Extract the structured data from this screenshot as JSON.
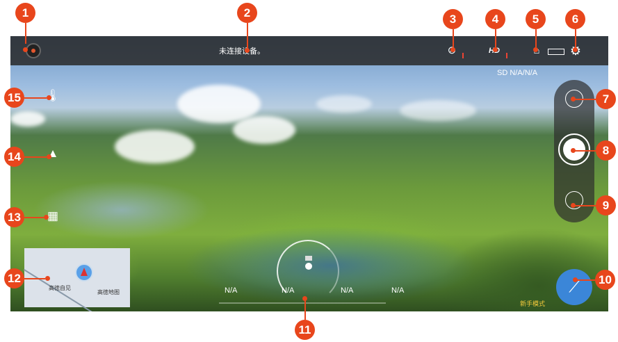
{
  "status": {
    "message": "未连接设备。"
  },
  "sd_card": "SD N/A/N/A",
  "flight_mode_label": "新手模式",
  "telemetry": [
    "N/A",
    "N/A",
    "N/A",
    "N/A"
  ],
  "map": {
    "label_left": "高徳自见",
    "label_right": "高徳地图"
  },
  "callouts": [
    "1",
    "2",
    "3",
    "4",
    "5",
    "6",
    "7",
    "8",
    "9",
    "10",
    "11",
    "12",
    "13",
    "14",
    "15"
  ],
  "icons": {
    "record": "record-icon",
    "no_gps": "satellite-off-icon",
    "hd_signal": "hd-signal-icon",
    "drone_signal": "drone-signal-icon",
    "battery": "battery-icon",
    "settings": "gear-icon",
    "camera_switch": "camera-switch-icon",
    "shutter": "shutter-icon",
    "video_mode": "video-mode-icon",
    "flight_mode": "wand-icon",
    "thermometer": "thermometer-icon",
    "takeoff": "takeoff-icon",
    "fullscreen": "fullscreen-icon"
  },
  "colors": {
    "accent": "#e8461c",
    "blue": "#3b86d8",
    "yellow": "#f3c93c"
  }
}
